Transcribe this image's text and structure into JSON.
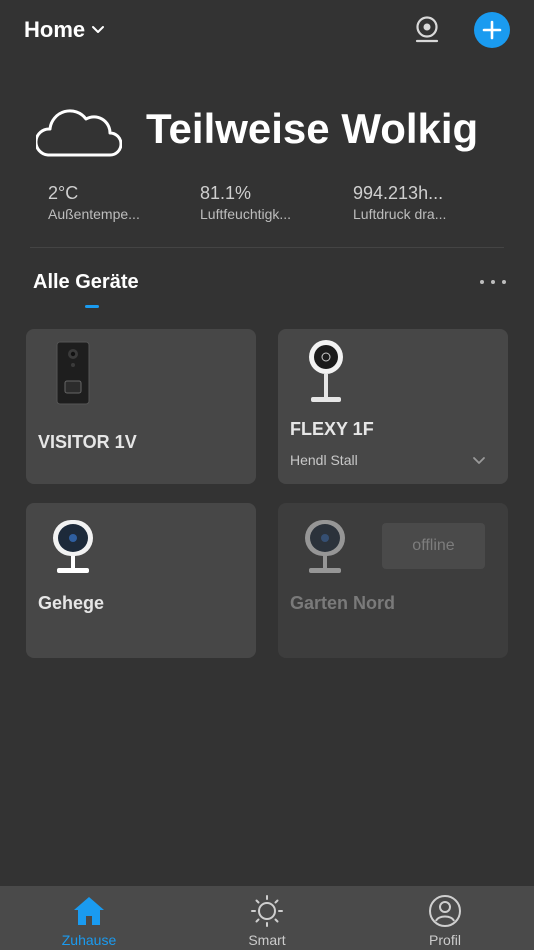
{
  "header": {
    "home_label": "Home",
    "icons": {
      "dropdown": "chevron-down-icon",
      "camera": "camera-view-icon",
      "add": "plus-icon"
    },
    "accent_color": "#1a9bf0"
  },
  "weather": {
    "condition": "Teilweise Wolkig",
    "icon": "cloud-icon",
    "stats": [
      {
        "value": "2°C",
        "label": "Außentempe..."
      },
      {
        "value": "81.1%",
        "label": "Luftfeuchtigk..."
      },
      {
        "value": "994.213h...",
        "label": "Luftdruck dra..."
      }
    ]
  },
  "devices_section": {
    "title": "Alle Geräte",
    "more_icon": "more-horizontal-icon"
  },
  "devices": [
    {
      "name": "VISITOR 1V",
      "subtitle": "",
      "status": "online",
      "icon": "video-doorbell-icon"
    },
    {
      "name": "FLEXY 1F",
      "subtitle": "Hendl Stall",
      "status": "online",
      "icon": "indoor-camera-icon"
    },
    {
      "name": "Gehege",
      "subtitle": "",
      "status": "online",
      "icon": "indoor-camera-icon"
    },
    {
      "name": "Garten Nord",
      "subtitle": "",
      "status": "offline",
      "status_label": "offline",
      "icon": "indoor-camera-icon"
    }
  ],
  "tabbar": {
    "tabs": [
      {
        "label": "Zuhause",
        "icon": "home-icon",
        "active": true
      },
      {
        "label": "Smart",
        "icon": "sun-icon",
        "active": false
      },
      {
        "label": "Profil",
        "icon": "user-profile-icon",
        "active": false
      }
    ]
  }
}
